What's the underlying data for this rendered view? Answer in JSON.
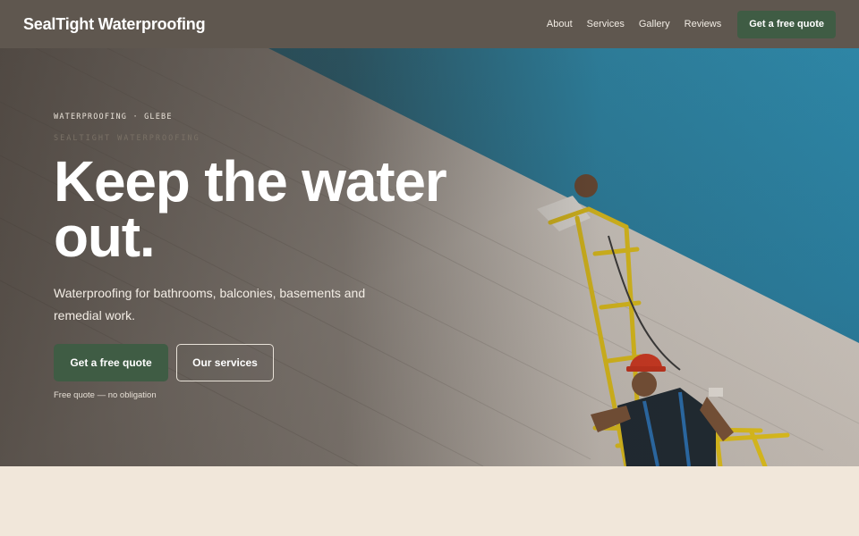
{
  "nav": {
    "brand": "SealTight Waterproofing",
    "links": [
      "About",
      "Services",
      "Gallery",
      "Reviews"
    ],
    "cta_label": "Get a free quote"
  },
  "hero": {
    "eyebrow": "WATERPROOFING · GLEBE",
    "eyebrow_sub": "SEALTIGHT WATERPROOFING",
    "headline_line1": "Keep the water",
    "headline_line2": "out.",
    "subhead": "Waterproofing for bathrooms, balconies, basements and remedial work.",
    "primary_button": "Get a free quote",
    "secondary_button": "Our services",
    "note": "Free quote — no obligation"
  },
  "colors": {
    "nav_bg": "#5f574f",
    "accent_green": "#3f5c44",
    "page_bg": "#f1e7da",
    "sky": "#2e8bad"
  }
}
